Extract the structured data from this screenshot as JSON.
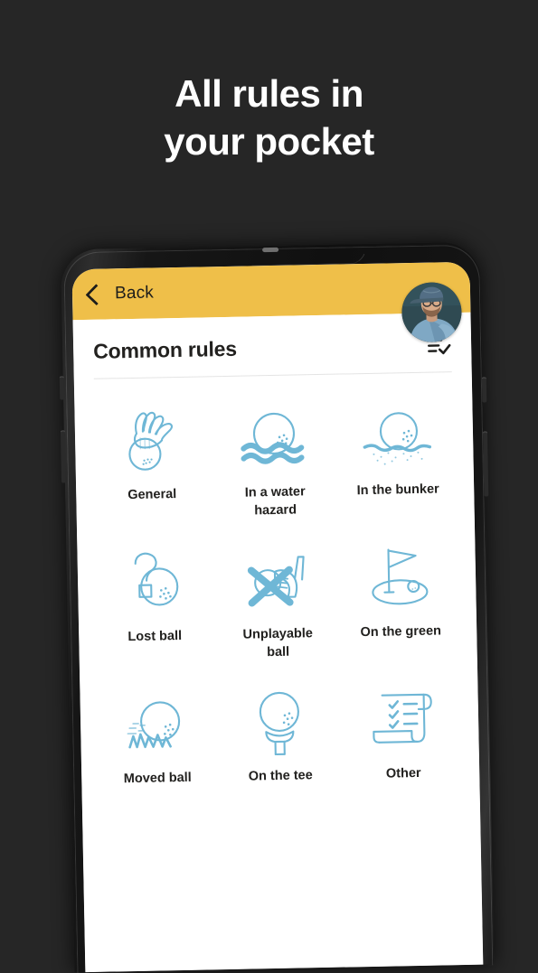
{
  "headline": {
    "line1": "All rules in",
    "line2": "your pocket"
  },
  "colors": {
    "background": "#262626",
    "header_yellow": "#EFBF49",
    "icon_blue": "#6FB7D6",
    "text_dark": "#22211F",
    "screen_white": "#FFFFFF",
    "divider_grey": "#E4E4E4"
  },
  "phone": {
    "topbar": {
      "back_label": "Back",
      "back_icon": "chevron-left-icon",
      "avatar_icon": "user-avatar-photo"
    },
    "screen": {
      "page_title": "Common rules",
      "list_icon": "list-check-icon",
      "grid": [
        {
          "label": "General",
          "icon": "hand-dropping-ball-icon"
        },
        {
          "label": "In a water hazard",
          "icon": "ball-in-water-icon"
        },
        {
          "label": "In the bunker",
          "icon": "ball-in-bunker-icon"
        },
        {
          "label": "Lost ball",
          "icon": "question-mark-ball-icon"
        },
        {
          "label": "Unplayable ball",
          "icon": "crossed-out-club-icon"
        },
        {
          "label": "On the green",
          "icon": "flag-on-green-icon"
        },
        {
          "label": "Moved ball",
          "icon": "ball-in-grass-icon"
        },
        {
          "label": "On the tee",
          "icon": "ball-on-tee-icon"
        },
        {
          "label": "Other",
          "icon": "scroll-checklist-icon"
        }
      ]
    }
  }
}
